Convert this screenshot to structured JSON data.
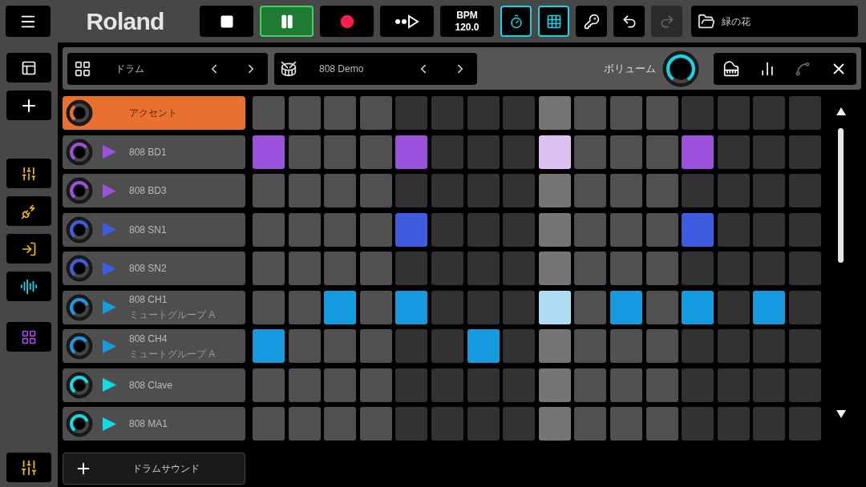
{
  "top_bar": {
    "logo": "Roland",
    "transport": [
      {
        "kind": "stop",
        "selected": false
      },
      {
        "kind": "pause",
        "selected": true
      },
      {
        "kind": "record",
        "selected": false
      },
      {
        "kind": "step",
        "selected": false
      }
    ],
    "bpm_label": "BPM",
    "bpm_value": "120.0",
    "metronome_on": true,
    "grid_on": true,
    "redo_disabled": true,
    "song": "緑の花"
  },
  "sidebar": [
    [
      {
        "kind": "layout"
      },
      {
        "kind": "add"
      }
    ],
    [
      {
        "kind": "tone"
      },
      {
        "kind": "plugin"
      },
      {
        "kind": "import"
      },
      {
        "kind": "wave"
      }
    ],
    [
      {
        "kind": "pads"
      }
    ],
    [
      {
        "kind": "mixer"
      }
    ]
  ],
  "toolbar": {
    "instrument": "ドラム",
    "kit": "808 Demo",
    "volume_label": "ボリューム",
    "volume": {
      "level": 0.8
    },
    "views": [
      {
        "kind": "piano",
        "disabled": false
      },
      {
        "kind": "bars",
        "disabled": false
      },
      {
        "kind": "curve",
        "disabled": true
      }
    ]
  },
  "playhead": [
    false,
    false,
    false,
    false,
    false,
    false,
    false,
    false,
    true,
    false,
    false,
    false,
    false,
    false,
    false,
    false
  ],
  "rows": [
    {
      "name": "アクセント",
      "kind": "accent",
      "color": "#e8712f",
      "level": 0.3,
      "steps": [
        false,
        false,
        false,
        false,
        false,
        false,
        false,
        false,
        false,
        false,
        false,
        false,
        false,
        false,
        false,
        false
      ]
    },
    {
      "name": "808 BD1",
      "kind": "sound",
      "color": "#9b51dc",
      "level": 0.55,
      "steps": [
        true,
        false,
        false,
        false,
        true,
        false,
        false,
        false,
        true,
        false,
        false,
        false,
        true,
        false,
        false,
        false
      ]
    },
    {
      "name": "808 BD3",
      "kind": "sound",
      "color": "#9b51dc",
      "level": 0.6,
      "steps": [
        false,
        false,
        false,
        false,
        false,
        false,
        false,
        false,
        false,
        false,
        false,
        false,
        false,
        false,
        false,
        false
      ]
    },
    {
      "name": "808 SN1",
      "kind": "sound",
      "color": "#3d5ce0",
      "level": 0.6,
      "steps": [
        false,
        false,
        false,
        false,
        true,
        false,
        false,
        false,
        false,
        false,
        false,
        false,
        true,
        false,
        false,
        false
      ]
    },
    {
      "name": "808 SN2",
      "kind": "sound",
      "color": "#3d5ce0",
      "level": 0.6,
      "steps": [
        false,
        false,
        false,
        false,
        false,
        false,
        false,
        false,
        false,
        false,
        false,
        false,
        false,
        false,
        false,
        false
      ]
    },
    {
      "name": "808 CH1",
      "kind": "sound",
      "color": "#149be0",
      "level": 0.6,
      "subtitle": "ミュートグループ A",
      "steps": [
        false,
        false,
        true,
        false,
        true,
        false,
        false,
        false,
        true,
        false,
        true,
        false,
        true,
        false,
        true,
        false
      ]
    },
    {
      "name": "808 CH4",
      "kind": "sound",
      "color": "#149be0",
      "level": 0.55,
      "subtitle": "ミュートグループ A",
      "steps": [
        true,
        false,
        false,
        false,
        false,
        false,
        true,
        false,
        false,
        false,
        false,
        false,
        false,
        false,
        false,
        false
      ]
    },
    {
      "name": "808 Clave",
      "kind": "sound",
      "color": "#14d9e6",
      "level": 0.6,
      "steps": [
        false,
        false,
        false,
        false,
        false,
        false,
        false,
        false,
        false,
        false,
        false,
        false,
        false,
        false,
        false,
        false
      ]
    },
    {
      "name": "808 MA1",
      "kind": "sound",
      "color": "#14d9e6",
      "level": 0.6,
      "steps": [
        false,
        false,
        false,
        false,
        false,
        false,
        false,
        false,
        false,
        false,
        false,
        false,
        false,
        false,
        false,
        false
      ]
    }
  ],
  "add_button": {
    "label": "ドラムサウンド"
  }
}
